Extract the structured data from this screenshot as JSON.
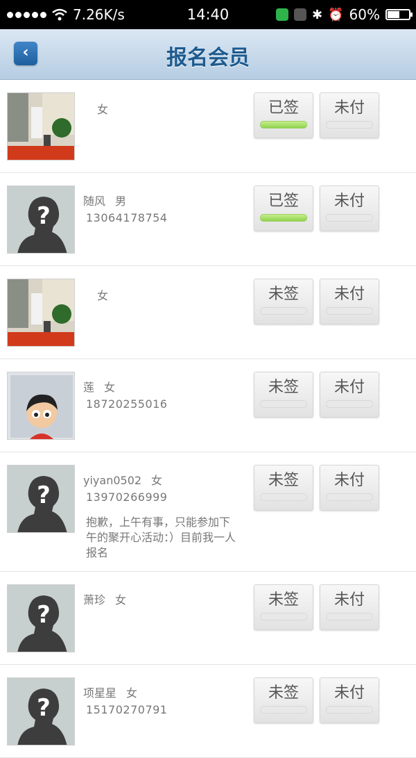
{
  "status_bar": {
    "speed": "7.26K/s",
    "time": "14:40",
    "battery": "60%",
    "battery_level": 0.6,
    "icons": [
      "signal-dots-icon",
      "wifi-icon",
      "shield-icon",
      "app-icon",
      "bluetooth-icon",
      "alarm-icon",
      "battery-icon"
    ]
  },
  "header": {
    "title": "报名会员",
    "back_icon": "back-chevron-icon"
  },
  "members": [
    {
      "name": "",
      "gender": "女",
      "phone": "",
      "note": "",
      "avatar": "photo-room",
      "sign_label": "已签",
      "sign_on": true,
      "pay_label": "未付",
      "height": 133
    },
    {
      "name": "随风",
      "gender": "男",
      "phone": "13064178754",
      "note": "",
      "avatar": "placeholder",
      "sign_label": "已签",
      "sign_on": true,
      "pay_label": "未付",
      "height": 133
    },
    {
      "name": "",
      "gender": "女",
      "phone": "",
      "note": "",
      "avatar": "photo-room",
      "sign_label": "未签",
      "sign_on": false,
      "pay_label": "未付",
      "height": 133
    },
    {
      "name": "莲",
      "gender": "女",
      "phone": "18720255016",
      "note": "",
      "avatar": "cartoon",
      "sign_label": "未签",
      "sign_on": false,
      "pay_label": "未付",
      "height": 133
    },
    {
      "name": "yiyan0502",
      "gender": "女",
      "phone": "13970266999",
      "note": "抱歉，上午有事，只能参加下午的聚开心活动：）目前我一人报名",
      "avatar": "placeholder",
      "sign_label": "未签",
      "sign_on": false,
      "pay_label": "未付",
      "height": 171
    },
    {
      "name": "萧珍",
      "gender": "女",
      "phone": "",
      "note": "",
      "avatar": "placeholder",
      "sign_label": "未签",
      "sign_on": false,
      "pay_label": "未付",
      "height": 133
    },
    {
      "name": "项星星",
      "gender": "女",
      "phone": "15170270791",
      "note": "",
      "avatar": "placeholder",
      "sign_label": "未签",
      "sign_on": false,
      "pay_label": "未付",
      "height": 133
    }
  ]
}
